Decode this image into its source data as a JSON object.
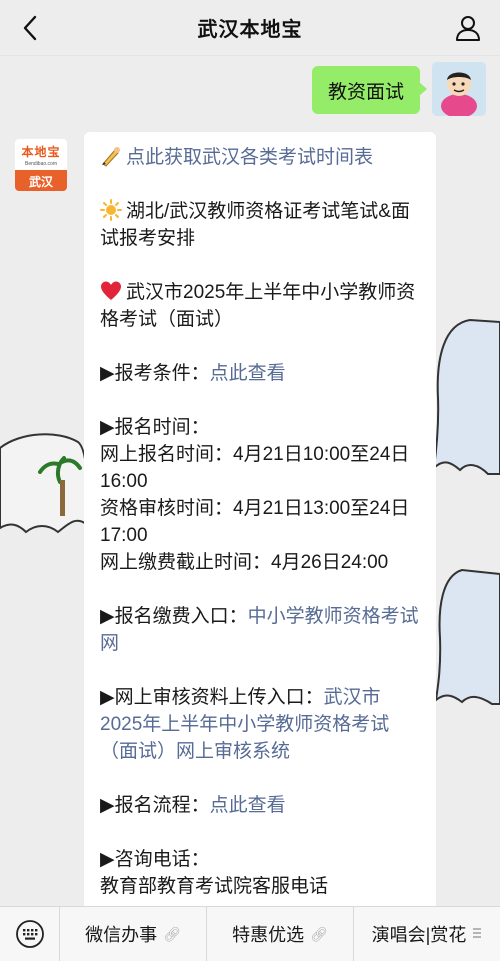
{
  "header": {
    "title": "武汉本地宝"
  },
  "outgoing": {
    "text": "教资面试"
  },
  "sender": {
    "logo_brand": "本地宝",
    "logo_url": "Bendibao.com",
    "logo_city": "武汉"
  },
  "message": {
    "line1_link": "点此获取武汉各类考试时间表",
    "p2": "湖北/武汉教师资格证考试笔试&面试报考安排",
    "p3": "武汉市2025年上半年中小学教师资格考试（面试）",
    "cond_label": "▶报考条件：",
    "cond_link": "点此查看",
    "time_label": "▶报名时间：",
    "time_online": "网上报名时间：4月21日10:00至24日16:00",
    "time_review": "资格审核时间：4月21日13:00至24日17:00",
    "time_pay": "网上缴费截止时间：4月26日24:00",
    "entry_label": "▶报名缴费入口：",
    "entry_link": "中小学教师资格考试网",
    "upload_label": "▶网上审核资料上传入口：",
    "upload_link": "武汉市2025年上半年中小学教师资格考试（面试）网上审核系统",
    "flow_label": "▶报名流程：",
    "flow_link": "点此查看",
    "phone_label": "▶咨询电话：",
    "phone_cut": "教育部教育考试院客服电话"
  },
  "menu": {
    "items": [
      "微信办事",
      "特惠优选",
      "演唱会|赏花"
    ]
  },
  "icons": {
    "back": "chevron-left-icon",
    "user": "user-icon",
    "keyboard": "keyboard-icon",
    "link": "link-icon"
  },
  "colors": {
    "outgoing_bubble": "#95ec69",
    "link": "#576b95",
    "logo_orange": "#e8612a"
  }
}
